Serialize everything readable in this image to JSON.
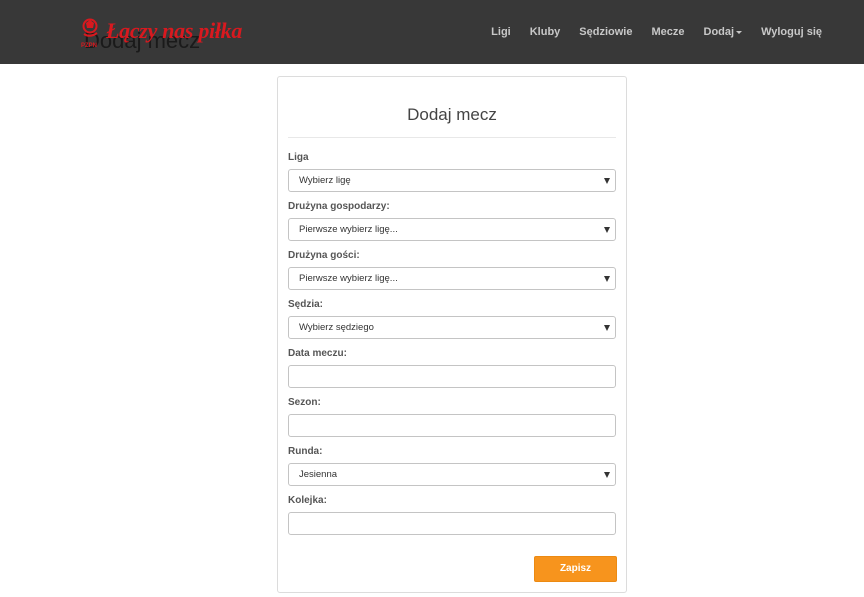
{
  "brand": {
    "ghost_title": "Dodaj mecz",
    "name": "Łączy nas piłka",
    "logo_text": "PZPN",
    "logo_color": "#d8191f"
  },
  "nav": {
    "items": [
      {
        "label": "Ligi"
      },
      {
        "label": "Kluby"
      },
      {
        "label": "Sędziowie"
      },
      {
        "label": "Mecze"
      },
      {
        "label": "Dodaj",
        "has_caret": true
      },
      {
        "label": "Wyloguj się"
      }
    ]
  },
  "form": {
    "title": "Dodaj mecz",
    "fields": {
      "liga": {
        "label": "Liga",
        "value": "Wybierz ligę",
        "type": "select"
      },
      "home": {
        "label": "Drużyna gospodarzy:",
        "value": "Pierwsze wybierz ligę...",
        "type": "select"
      },
      "away": {
        "label": "Drużyna gości:",
        "value": "Pierwsze wybierz ligę...",
        "type": "select"
      },
      "referee": {
        "label": "Sędzia:",
        "value": "Wybierz sędziego",
        "type": "select"
      },
      "date": {
        "label": "Data meczu:",
        "value": "",
        "type": "text"
      },
      "season": {
        "label": "Sezon:",
        "value": "",
        "type": "text"
      },
      "round": {
        "label": "Runda:",
        "value": "Jesienna",
        "type": "select"
      },
      "queue": {
        "label": "Kolejka:",
        "value": "",
        "type": "text"
      }
    },
    "submit_label": "Zapisz",
    "accent_color": "#f7941d"
  }
}
